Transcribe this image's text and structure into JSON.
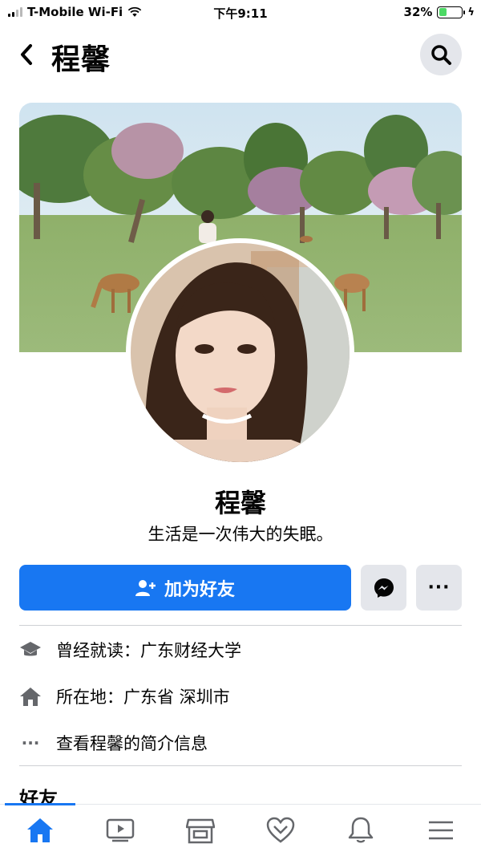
{
  "status_bar": {
    "carrier": "T-Mobile Wi-Fi",
    "time": "下午9:11",
    "battery_percent": "32%",
    "battery_level": 0.32,
    "battery_color": "#4cd964"
  },
  "header": {
    "title": "程馨",
    "back_icon": "chevron-left-icon",
    "search_icon": "search-icon"
  },
  "profile": {
    "name": "程馨",
    "bio": "生活是一次伟大的失眠。"
  },
  "actions": {
    "add_friend_label": "加为好友",
    "add_friend_icon": "add-person-icon",
    "messenger_icon": "messenger-icon",
    "more_label": "···"
  },
  "info": {
    "education": "曾经就读：广东财经大学",
    "location": "所在地：广东省 深圳市",
    "view_about": "查看程馨的简介信息"
  },
  "friends": {
    "heading": "好友"
  },
  "bottom_nav": {
    "tabs": [
      {
        "name": "home",
        "icon": "home-icon",
        "active": true
      },
      {
        "name": "watch",
        "icon": "video-icon",
        "active": false
      },
      {
        "name": "marketplace",
        "icon": "store-icon",
        "active": false
      },
      {
        "name": "dating",
        "icon": "heart-icon",
        "active": false
      },
      {
        "name": "notifications",
        "icon": "bell-icon",
        "active": false
      },
      {
        "name": "menu",
        "icon": "menu-icon",
        "active": false
      }
    ]
  },
  "colors": {
    "accent": "#1877f2",
    "button_gray": "#e4e6eb",
    "divider": "#ced0d4"
  }
}
